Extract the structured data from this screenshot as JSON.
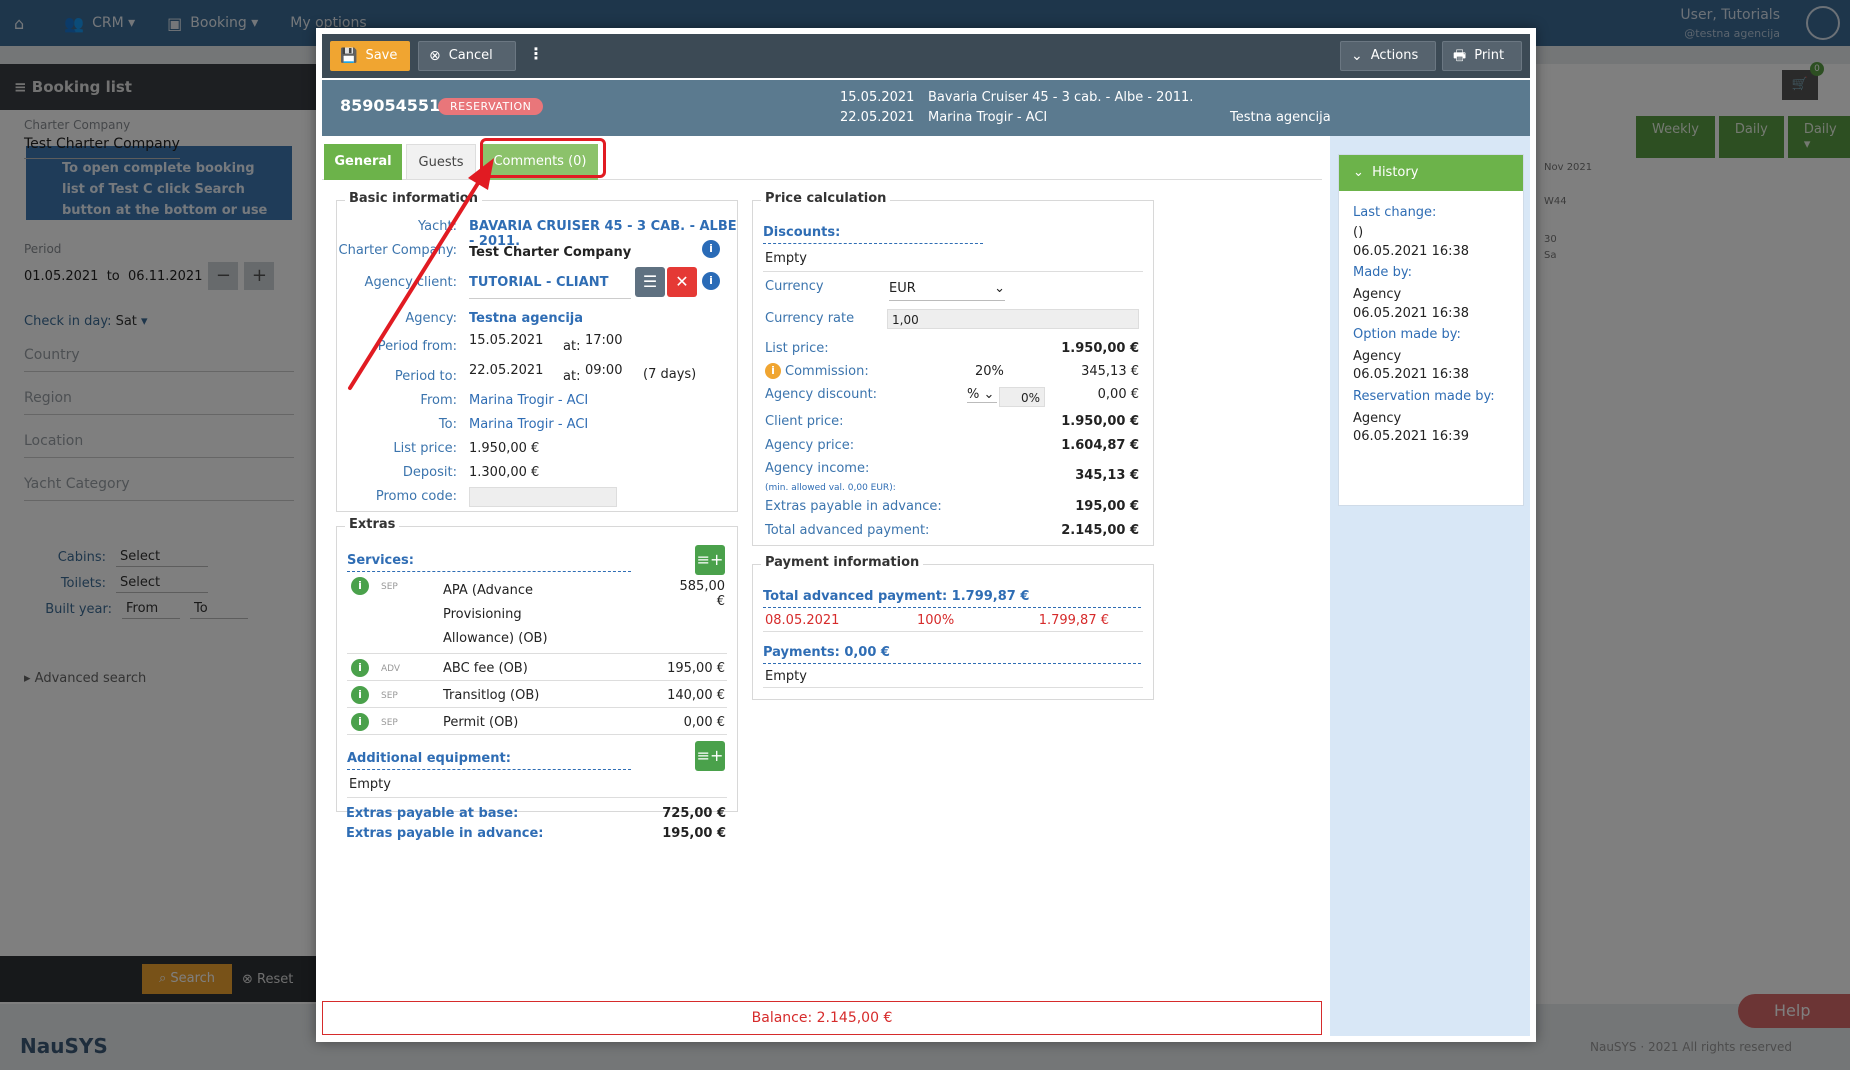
{
  "bg": {
    "nav": [
      "CRM",
      "Booking",
      "My options"
    ],
    "user": "User, Tutorials",
    "user_sub": "@testna agencija",
    "left_title": "Booking list",
    "charter_label": "Charter Company",
    "charter_value": "Test Charter Company",
    "info_text": "To open complete booking list of Test C click Search button at the bottom or use ad below.",
    "period_label": "Period",
    "period_from": "01.05.2021",
    "period_to_word": "to",
    "period_to": "06.11.2021",
    "checkin_label": "Check in day:",
    "checkin_value": "Sat",
    "country": "Country",
    "region": "Region",
    "location": "Location",
    "yacht_cat": "Yacht Category",
    "cabins": "Cabins:",
    "toilets": "Toilets:",
    "built_year": "Built year:",
    "select": "Select",
    "from": "From",
    "to": "To",
    "advanced": "Advanced search",
    "search": "Search",
    "reset": "Reset",
    "logo": "NauSYS",
    "tabs_right": [
      "Weekly",
      "Daily",
      "Daily"
    ],
    "help": "Help",
    "footer": "NauSYS · 2021 All rights reserved",
    "cart_count": "0",
    "cal_month": "Nov 2021",
    "cal_week": "W44",
    "cal_day": "30",
    "cal_dayname": "Sa"
  },
  "toolbar": {
    "save": "Save",
    "cancel": "Cancel",
    "actions": "Actions",
    "print": "Print"
  },
  "header": {
    "booking_no": "859054551",
    "status": "RESERVATION",
    "date_from": "15.05.2021",
    "date_to": "22.05.2021",
    "yacht": "Bavaria Cruiser 45 - 3 cab. - Albe - 2011.",
    "marina": "Marina Trogir - ACI",
    "agency": "Testna agencija"
  },
  "tabs": {
    "general": "General",
    "guests": "Guests",
    "comments": "Comments (0)"
  },
  "basic": {
    "title": "Basic information",
    "yacht_lbl": "Yacht:",
    "yacht": "BAVARIA CRUISER 45 - 3 CAB. - ALBE - 2011.",
    "charter_lbl": "Charter Company:",
    "charter": "Test Charter Company",
    "client_lbl": "Agency client:",
    "client": "TUTORIAL - CLIANT",
    "agency_lbl": "Agency:",
    "agency": "Testna agencija",
    "pfrom_lbl": "Period from:",
    "pfrom": "15.05.2021",
    "at": "at:",
    "pfrom_time": "17:00",
    "pto_lbl": "Period to:",
    "pto": "22.05.2021",
    "pto_time": "09:00",
    "days": "(7 days)",
    "from_lbl": "From:",
    "from": "Marina Trogir - ACI",
    "to_lbl": "To:",
    "to": "Marina Trogir - ACI",
    "list_lbl": "List price:",
    "list": "1.950,00 €",
    "deposit_lbl": "Deposit:",
    "deposit": "1.300,00 €",
    "promo_lbl": "Promo code:"
  },
  "extras": {
    "title": "Extras",
    "services_lbl": "Services:",
    "services": [
      {
        "tag": "SEP",
        "name": "APA (Advance Provisioning Allowance) (OB)",
        "price": "585,00 €"
      },
      {
        "tag": "ADV",
        "name": "ABC fee (OB)",
        "price": "195,00 €"
      },
      {
        "tag": "SEP",
        "name": "Transitlog (OB)",
        "price": "140,00 €"
      },
      {
        "tag": "SEP",
        "name": "Permit (OB)",
        "price": "0,00 €"
      }
    ],
    "equip_lbl": "Additional equipment:",
    "equip_empty": "Empty",
    "base_lbl": "Extras payable at base:",
    "base": "725,00 €",
    "adv_lbl": "Extras payable in advance:",
    "adv": "195,00 €"
  },
  "price": {
    "title": "Price calculation",
    "discounts_lbl": "Discounts:",
    "discounts_empty": "Empty",
    "currency_lbl": "Currency",
    "currency": "EUR",
    "rate_lbl": "Currency rate",
    "rate": "1,00",
    "list_lbl": "List price:",
    "list": "1.950,00 €",
    "comm_lbl": "Commission:",
    "comm_pct": "20%",
    "comm": "345,13 €",
    "adisc_lbl": "Agency discount:",
    "adisc_unit": "%",
    "adisc_pct": "0%",
    "adisc": "0,00 €",
    "client_lbl": "Client price:",
    "client": "1.950,00 €",
    "agency_lbl": "Agency price:",
    "agency": "1.604,87 €",
    "income_lbl": "Agency income:",
    "income": "345,13 €",
    "income_note": "(min. allowed val. 0,00 EUR):",
    "extras_lbl": "Extras payable in advance:",
    "extras": "195,00 €",
    "total_lbl": "Total advanced payment:",
    "total": "2.145,00 €"
  },
  "payment": {
    "title": "Payment information",
    "total_lbl": "Total advanced payment: 1.799,87 €",
    "row_date": "08.05.2021",
    "row_pct": "100%",
    "row_amt": "1.799,87 €",
    "payments_lbl": "Payments: 0,00 €",
    "empty": "Empty"
  },
  "history": {
    "title": "History",
    "last_lbl": "Last change:",
    "last_who": "()",
    "last_date": "06.05.2021 16:38",
    "made_lbl": "Made by:",
    "made_who": "Agency",
    "made_date": "06.05.2021 16:38",
    "opt_lbl": "Option made by:",
    "opt_who": "Agency",
    "opt_date": "06.05.2021 16:38",
    "res_lbl": "Reservation made by:",
    "res_who": "Agency",
    "res_date": "06.05.2021 16:39"
  },
  "balance": "Balance: 2.145,00 €",
  "colors": {
    "accent_green": "#6cb34a",
    "save_orange": "#f0a531",
    "annotation_red": "#e11b22",
    "link_blue": "#2f6db4"
  }
}
